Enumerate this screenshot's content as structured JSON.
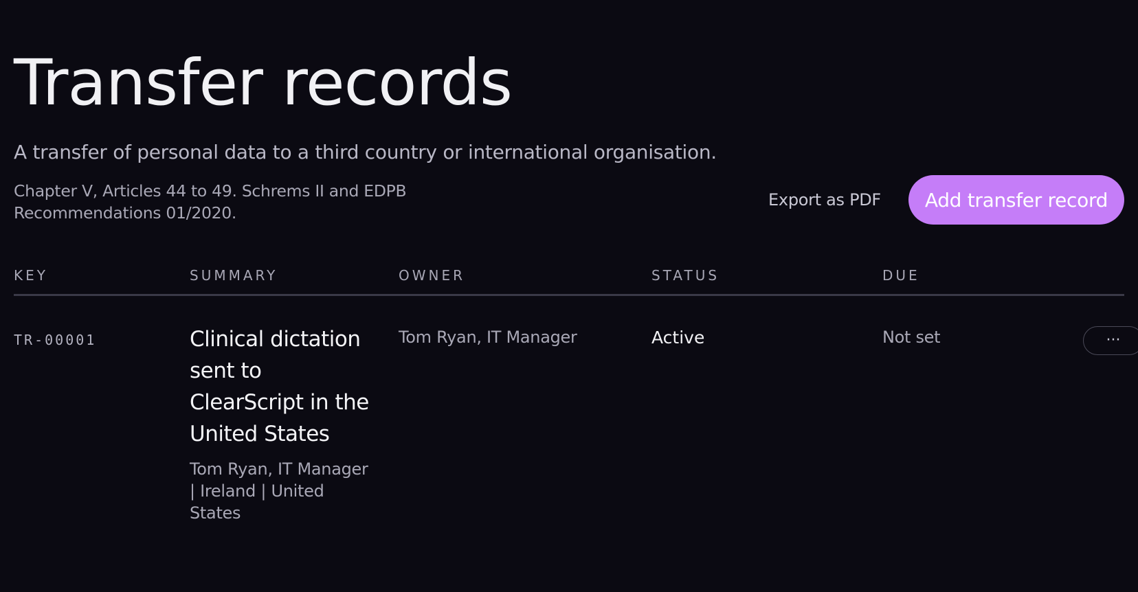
{
  "header": {
    "title": "Transfer records",
    "subtitle": "A transfer of personal data to a third country or international organisation.",
    "reference": "Chapter V, Articles 44 to 49. Schrems II and EDPB Recommendations 01/2020."
  },
  "actions": {
    "export_label": "Export as PDF",
    "add_label": "Add transfer record"
  },
  "table": {
    "columns": [
      "KEY",
      "SUMMARY",
      "OWNER",
      "STATUS",
      "DUE"
    ],
    "rows": [
      {
        "key": "TR-00001",
        "summary_title": "Clinical dictation sent to ClearScript in the United States",
        "summary_meta": "Tom Ryan, IT Manager | Ireland | United States",
        "owner": "Tom Ryan, IT Manager",
        "status": "Active",
        "due": "Not set",
        "more_label": "···"
      }
    ]
  },
  "colors": {
    "background": "#0b0a12",
    "accent": "#c57df8",
    "text_primary": "#f1f1f4",
    "text_muted": "#a9a8b6",
    "divider": "#3a3947"
  },
  "icons": {
    "more": "more-horizontal-icon"
  }
}
